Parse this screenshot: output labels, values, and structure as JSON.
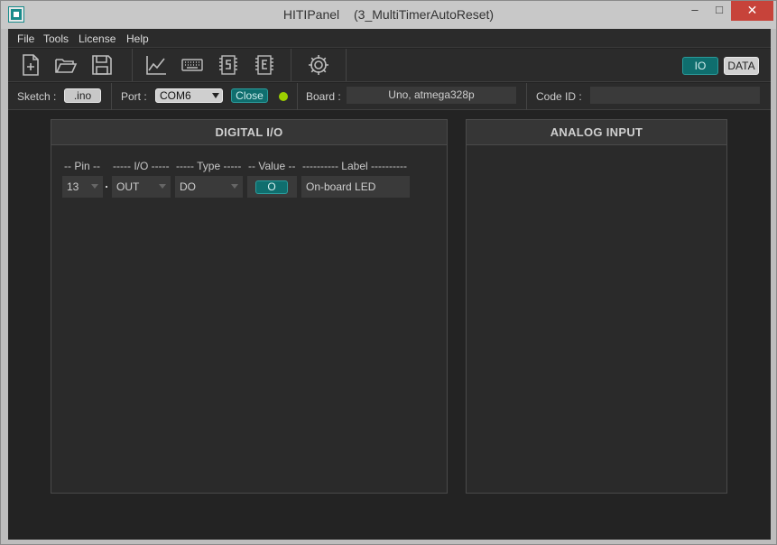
{
  "window": {
    "app_name": "HITIPanel",
    "document_name": "(3_MultiTimerAutoReset)",
    "min_glyph": "–",
    "max_glyph": "□",
    "close_glyph": "✕"
  },
  "menu": [
    "File",
    "Tools",
    "License",
    "Help"
  ],
  "toolbar": {
    "icons": [
      "new-file-icon",
      "open-folder-icon",
      "save-icon",
      "chart-icon",
      "keyboard-icon",
      "s-chip-icon",
      "e-chip-icon",
      "gear-icon"
    ],
    "mode_io": "IO",
    "mode_data": "DATA"
  },
  "connection": {
    "sketch_label": "Sketch :",
    "sketch_button": ".ino",
    "port_label": "Port :",
    "port_value": "COM6",
    "close_button": "Close",
    "board_label": "Board :",
    "board_value": "Uno, atmega328p",
    "codeid_label": "Code ID :",
    "codeid_value": "",
    "led_color": "#9ccf00"
  },
  "digital_io": {
    "title": "DIGITAL  I/O",
    "headers": {
      "pin": "-- Pin --",
      "io": "----- I/O -----",
      "type": "----- Type -----",
      "value": "-- Value --",
      "label": "---------- Label ----------"
    },
    "rows": [
      {
        "pin": "13",
        "io": "OUT",
        "type": "DO",
        "value": "O",
        "label": "On-board LED"
      }
    ]
  },
  "analog_input": {
    "title": "ANALOG  INPUT"
  },
  "colors": {
    "accent": "#0f6e6e",
    "background": "#232323",
    "close_red": "#c7433a"
  }
}
